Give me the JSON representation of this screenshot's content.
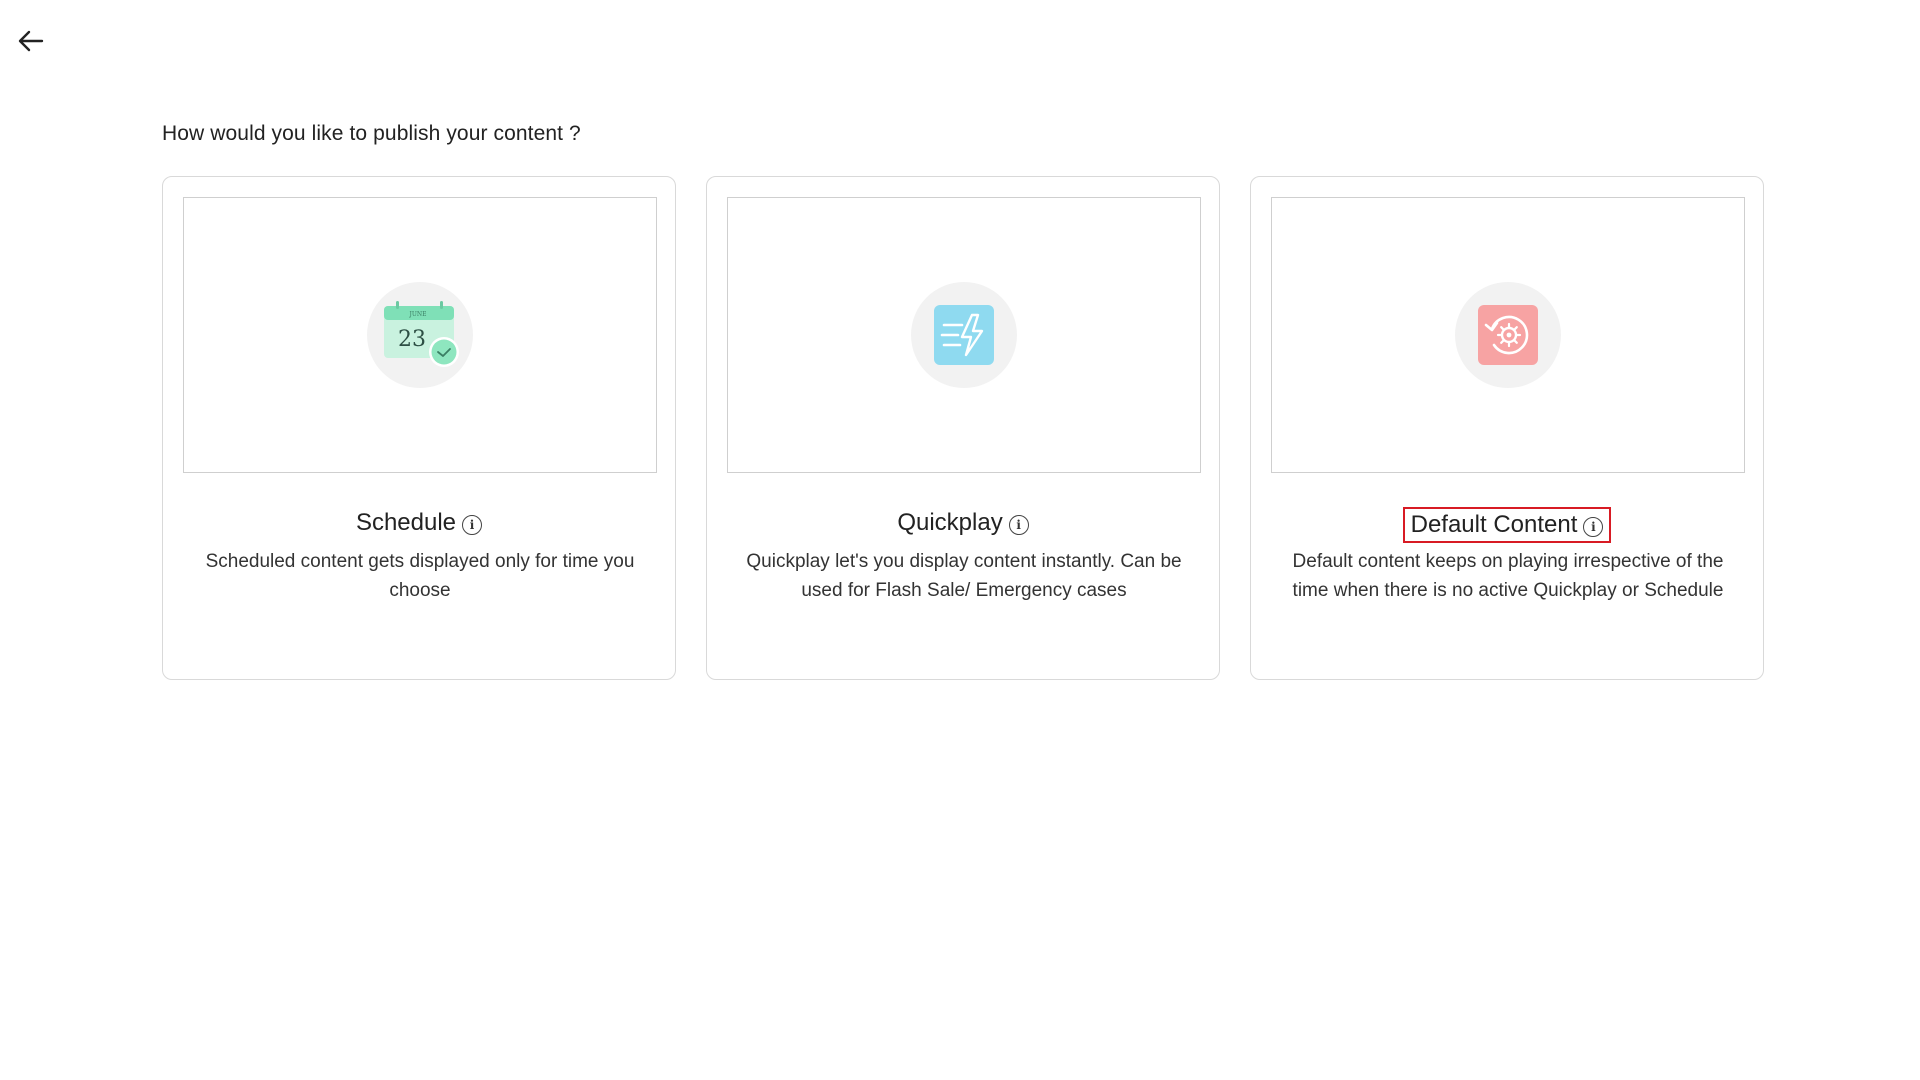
{
  "header": {
    "back_icon": "arrow-left-icon"
  },
  "prompt": "How would you like to publish your content ?",
  "cards": [
    {
      "title": "Schedule",
      "description": "Scheduled content gets displayed only for time you choose",
      "icon": "calendar-icon",
      "calendar_month": "JUNE",
      "calendar_day": "23",
      "accent": "#5fd4a6"
    },
    {
      "title": "Quickplay",
      "description": "Quickplay let's you display content instantly. Can be used for Flash Sale/ Emergency cases",
      "icon": "lightning-icon",
      "accent": "#8fdaf0"
    },
    {
      "title": "Default Content",
      "description": "Default content keeps on playing irrespective of the time when there is no active Quickplay or Schedule",
      "icon": "refresh-gear-icon",
      "accent": "#f7a3a3",
      "highlight_color": "#d81b24"
    }
  ]
}
